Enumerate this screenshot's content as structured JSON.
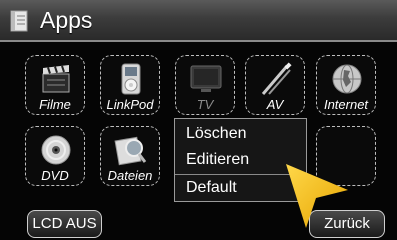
{
  "header": {
    "title": "Apps"
  },
  "tiles": [
    {
      "label": "Filme",
      "icon": "clapperboard-icon"
    },
    {
      "label": "LinkPod",
      "icon": "ipod-icon"
    },
    {
      "label": "TV",
      "icon": "tv-icon"
    },
    {
      "label": "AV",
      "icon": "av-cable-icon"
    },
    {
      "label": "Internet",
      "icon": "globe-icon"
    },
    {
      "label": "DVD",
      "icon": "disc-icon"
    },
    {
      "label": "Dateien",
      "icon": "magnifier-icon"
    }
  ],
  "context_menu": {
    "items": [
      "Löschen",
      "Editieren",
      "Default"
    ]
  },
  "footer": {
    "lcd_off_label": "LCD AUS",
    "back_label": "Zurück"
  },
  "colors": {
    "cursor": "#f5b800",
    "title_bar": "#454545"
  }
}
